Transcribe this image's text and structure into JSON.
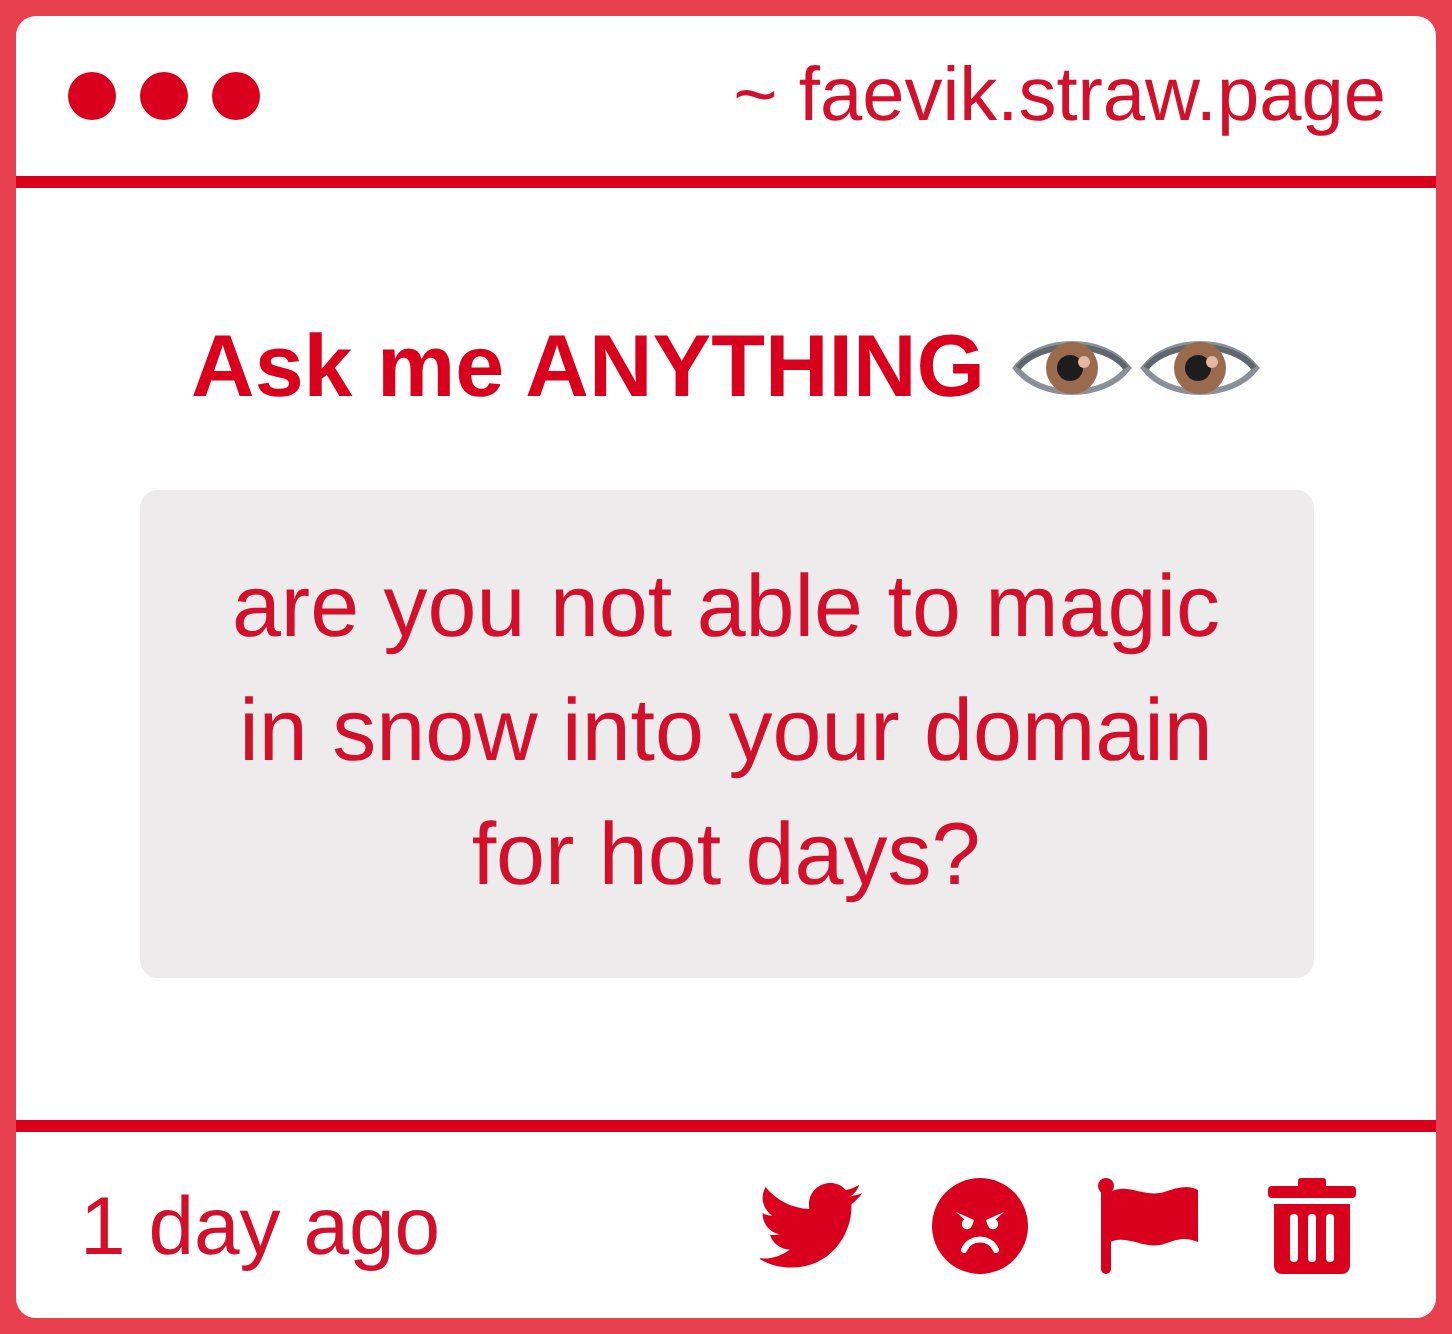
{
  "header": {
    "domain": "~ faevik.straw.page"
  },
  "question": {
    "title": "Ask me ANYTHING",
    "text": "are you not able to magic in snow into your domain for hot days?"
  },
  "footer": {
    "time": "1 day ago"
  }
}
